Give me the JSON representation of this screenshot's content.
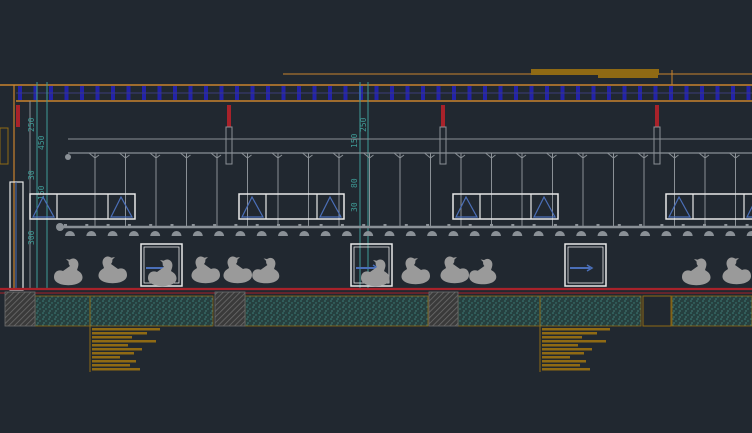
{
  "drawing": {
    "background": "#212830",
    "colors": {
      "roof_orange": "#c9832e",
      "purlin_blue": "#2323a8",
      "pipe_gray": "#8a9096",
      "dimension_teal": "#3f9c97",
      "window_white": "#e8e8e8",
      "window_glass": "#4b6fb8",
      "slab_red": "#a8222a",
      "soil_fill": "#3c7f7a",
      "footing_gray": "#6e6e6e",
      "note_gold": "#8f6a14",
      "duck_gray": "#9a9a9a"
    },
    "dimension_labels": {
      "left": [
        "250",
        "450",
        "150",
        "300",
        "30"
      ],
      "middle": [
        "150",
        "250",
        "80",
        "30"
      ]
    },
    "icons": {
      "duck": "duck-silhouette-icon",
      "fan": "ceiling-fan-icon",
      "window": "window-icon",
      "drain": "floor-drain-icon"
    }
  }
}
